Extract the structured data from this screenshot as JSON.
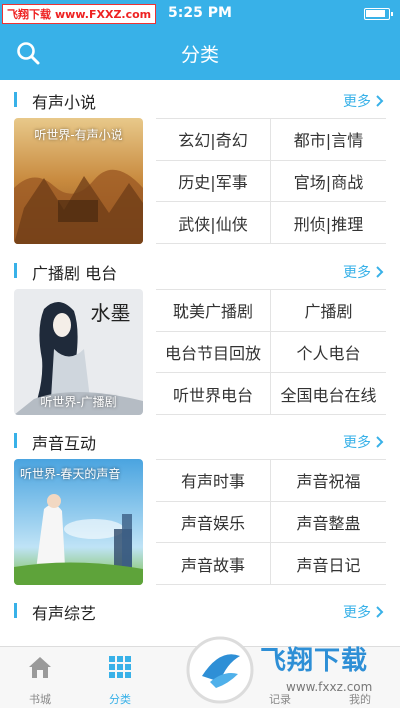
{
  "status_bar": {
    "time": "5:25 PM"
  },
  "watermark": {
    "site_cn": "飞翔下载",
    "site_url": "www.FXXZ.com",
    "brand": "飞翔下载",
    "brand_url": "www.fxxz.com"
  },
  "header": {
    "title": "分类"
  },
  "sections": [
    {
      "title": "有声小说",
      "more": "更多",
      "cover_label": "听世界-有声小说",
      "items": [
        "玄幻|奇幻",
        "都市|言情",
        "历史|军事",
        "官场|商战",
        "武侠|仙侠",
        "刑侦|推理"
      ]
    },
    {
      "title": "广播剧 电台",
      "more": "更多",
      "cover_label": "听世界-广播剧",
      "cover_mark": "水墨",
      "items": [
        "耽美广播剧",
        "广播剧",
        "电台节目回放",
        "个人电台",
        "听世界电台",
        "全国电台在线"
      ]
    },
    {
      "title": "声音互动",
      "more": "更多",
      "cover_label": "听世界-春天的声音",
      "items": [
        "有声时事",
        "声音祝福",
        "声音娱乐",
        "声音整蛊",
        "声音故事",
        "声音日记"
      ]
    },
    {
      "title": "有声综艺",
      "more": "更多"
    }
  ],
  "tabbar": {
    "tabs": [
      {
        "label": "书城",
        "icon": "home-icon"
      },
      {
        "label": "分类",
        "icon": "grid-icon"
      },
      {
        "label": "",
        "icon": ""
      },
      {
        "label": "记录",
        "icon": "record-icon"
      },
      {
        "label": "我的",
        "icon": "user-icon"
      }
    ],
    "active_color": "#38b1e8"
  },
  "colors": {
    "primary": "#38b1e8",
    "divider": "#e3e3e3"
  }
}
